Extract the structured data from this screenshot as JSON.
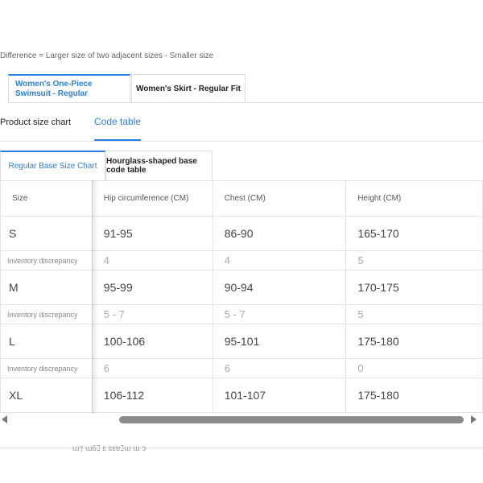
{
  "note": "Difference = Larger size of two adjacent sizes - Smaller size",
  "product_tabs": [
    {
      "label": "Women's One-Piece Swimsuit - Regular",
      "active": true
    },
    {
      "label": "Women's Skirt - Regular Fit",
      "active": false
    }
  ],
  "sub_tabs": [
    {
      "label": "Product size chart",
      "active": false
    },
    {
      "label": "Code table",
      "active": true
    }
  ],
  "chart_tabs": [
    {
      "label": "Regular Base Size Chart",
      "active": true
    },
    {
      "label": "Hourglass-shaped base code table",
      "active": false
    }
  ],
  "table": {
    "headers": [
      "Size",
      "Hip circumference (CM)",
      "Chest (CM)",
      "Height (CM)"
    ],
    "rows": [
      {
        "size": "S",
        "values": [
          "91-95",
          "86-90",
          "165-170"
        ]
      },
      {
        "discrepancy_label": "Inventory discrepancy",
        "values": [
          "4",
          "4",
          "5"
        ]
      },
      {
        "size": "M",
        "values": [
          "95-99",
          "90-94",
          "170-175"
        ]
      },
      {
        "discrepancy_label": "Inventory discrepancy",
        "values": [
          "5 - 7",
          "5 - 7",
          "5"
        ]
      },
      {
        "size": "L",
        "values": [
          "100-106",
          "95-101",
          "175-180"
        ]
      },
      {
        "discrepancy_label": "Inventory discrepancy",
        "values": [
          "6",
          "6",
          "0"
        ]
      },
      {
        "size": "XL",
        "values": [
          "106-112",
          "101-107",
          "175-180"
        ]
      }
    ]
  },
  "footer_text": "ɯ⁊  ɯ6ℷ  ɛ ɛɛɐℷɯ ɯ ɔ"
}
